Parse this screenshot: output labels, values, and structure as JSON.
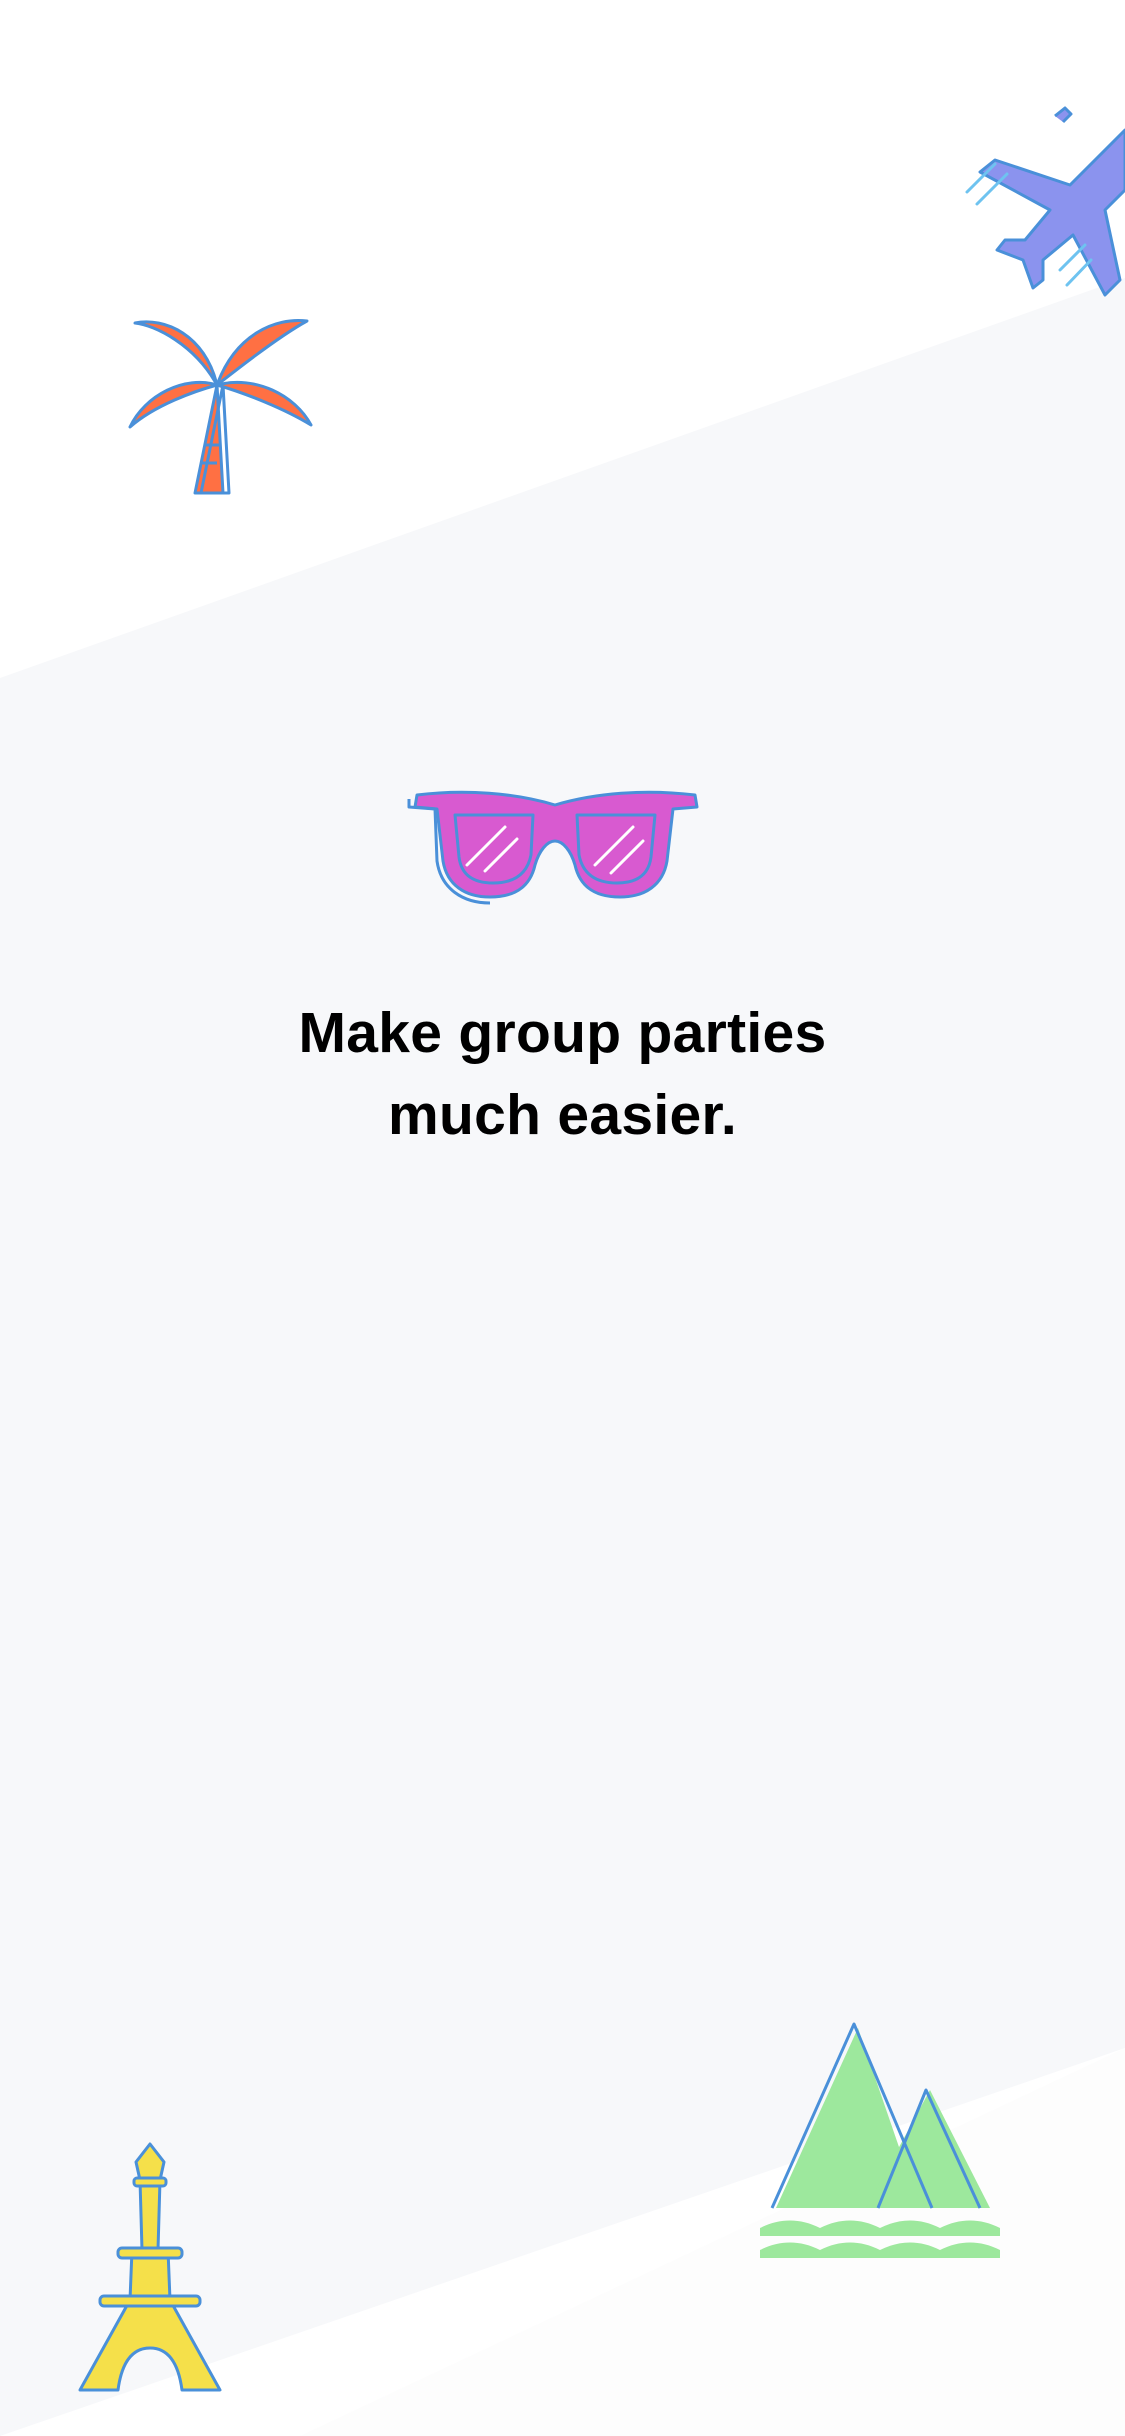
{
  "onboarding": {
    "headline_line1": "Make group parties",
    "headline_line2": "much easier."
  },
  "colors": {
    "page_white": "#ffffff",
    "band_grey": "#f7f8fa",
    "outline_blue": "#4a90d9",
    "palm_orange": "#ff7043",
    "plane_periwinkle": "#8b93ee",
    "glasses_magenta": "#d85ad0",
    "mountain_green": "#9de89d",
    "tower_yellow": "#f5e04a"
  },
  "icons": {
    "palm": "palm-tree-icon",
    "plane": "airplane-icon",
    "glasses": "sunglasses-icon",
    "mountains": "mountains-icon",
    "tower": "eiffel-tower-icon"
  }
}
